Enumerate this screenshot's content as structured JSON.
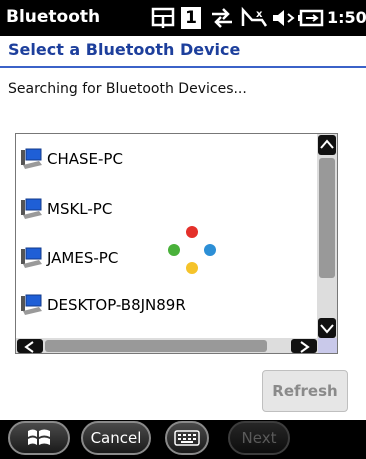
{
  "status_bar": {
    "app_name": "Bluetooth",
    "time": "1:50",
    "indicator_number": "1",
    "icons": [
      "battery-icon",
      "speaker-icon",
      "signal-icon",
      "sync-icon",
      "notification-icon"
    ]
  },
  "header": {
    "title": "Select a Bluetooth Device"
  },
  "status_text": "Searching for Bluetooth Devices...",
  "devices": [
    {
      "name": "CHASE-PC",
      "icon": "computer-icon"
    },
    {
      "name": "MSKL-PC",
      "icon": "computer-icon"
    },
    {
      "name": "JAMES-PC",
      "icon": "computer-icon"
    },
    {
      "name": "DESKTOP-B8JN89R",
      "icon": "computer-icon"
    }
  ],
  "refresh_label": "Refresh",
  "taskbar": {
    "cancel_label": "Cancel",
    "next_label": "Next",
    "icons": [
      "start-windows-icon",
      "keyboard-icon"
    ]
  },
  "colors": {
    "header_text": "#1d3f9c",
    "header_rule": "#3b62c8",
    "spinner": [
      "#e4302a",
      "#49b13a",
      "#2c8fd6",
      "#f5c32a"
    ]
  }
}
